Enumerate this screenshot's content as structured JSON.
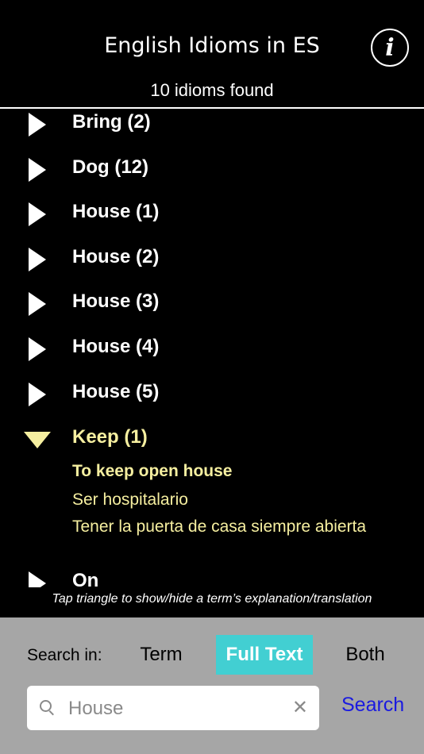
{
  "header": {
    "title": "English Idioms in ES",
    "info_glyph": "i",
    "result_count": "10 idioms found"
  },
  "list": {
    "rows": [
      {
        "label": "Bring (2)",
        "state": "collapsed"
      },
      {
        "label": "Dog (12)",
        "state": "collapsed"
      },
      {
        "label": "House (1)",
        "state": "collapsed"
      },
      {
        "label": "House (2)",
        "state": "collapsed"
      },
      {
        "label": "House (3)",
        "state": "collapsed"
      },
      {
        "label": "House (4)",
        "state": "collapsed"
      },
      {
        "label": "House (5)",
        "state": "collapsed"
      },
      {
        "label": "Keep (1)",
        "state": "expanded"
      },
      {
        "label": "On",
        "state": "collapsed"
      }
    ],
    "expanded": {
      "term": "To keep open house",
      "translations": [
        "Ser hospitalario",
        "Tener la puerta de casa siempre abierta"
      ]
    }
  },
  "hint": "Tap triangle to show/hide a term’s explanation/translation",
  "search": {
    "search_in_label": "Search in:",
    "options": [
      "Term",
      "Full Text",
      "Both"
    ],
    "selected": "Full Text",
    "value": "House",
    "clear_glyph": "✕",
    "button_label": "Search"
  },
  "colors": {
    "background": "#000000",
    "expanded_text": "#f6efa0",
    "selected_segment": "#42cfd2",
    "search_button": "#1a1ae0",
    "panel": "#a6a6a6"
  }
}
